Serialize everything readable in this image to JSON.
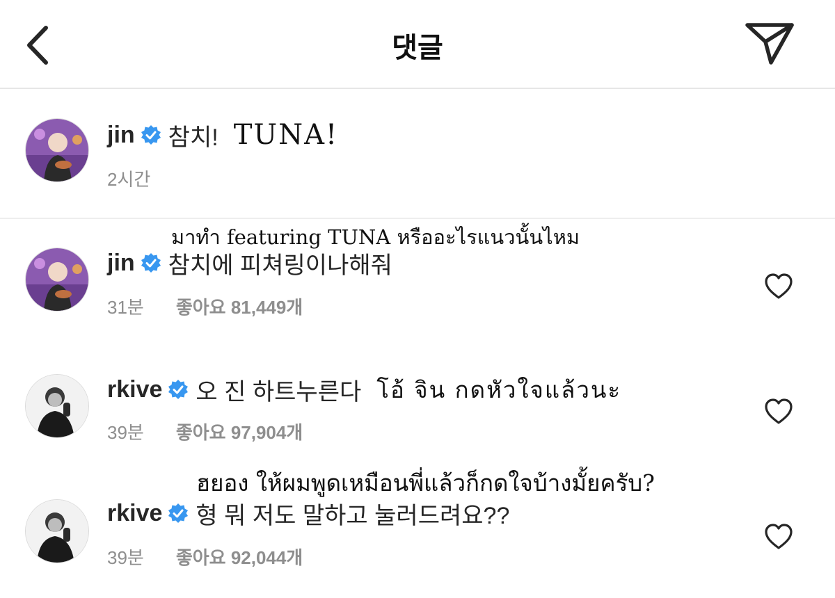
{
  "header": {
    "title": "댓글"
  },
  "comments": [
    {
      "username": "jin",
      "text": "참치!",
      "translation": "TUNA!",
      "time": "2시간"
    },
    {
      "translation": "มาทำ featuring TUNA หรืออะไรแนวนั้นไหม",
      "username": "jin",
      "text": "참치에 피쳐링이나해줘",
      "time": "31분",
      "likes": "좋아요 81,449개"
    },
    {
      "username": "rkive",
      "text": "오 진 하트누른다",
      "translation": "โอ้ จิน กดหัวใจแล้วนะ",
      "time": "39분",
      "likes": "좋아요 97,904개"
    },
    {
      "translation": "ฮยอง ให้ผมพูดเหมือนพี่แล้วก็กดใจบ้างมั้ยครับ?",
      "username": "rkive",
      "text": "형 뭐 저도 말하고 눌러드려요??",
      "time": "39분",
      "likes": "좋아요 92,044개"
    }
  ],
  "icons": {
    "back": "chevron-left-icon",
    "send": "paper-plane-icon",
    "verified": "verified-badge-icon",
    "like": "heart-outline-icon"
  },
  "colors": {
    "verified": "#3897f0",
    "muted": "#8e8e8e",
    "text": "#262626"
  }
}
